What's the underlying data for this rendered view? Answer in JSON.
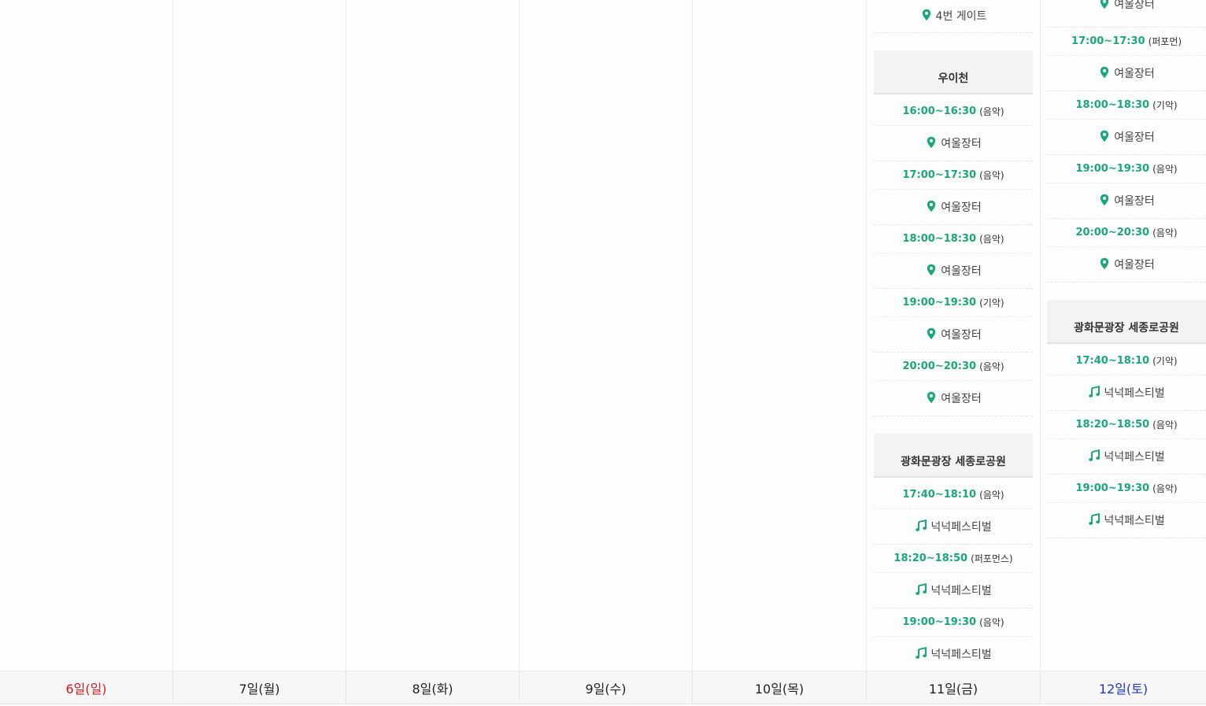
{
  "colors": {
    "time": "#1aa77a",
    "icon": "#1aa77a",
    "sunday": "#d11a1a",
    "saturday": "#2233cc"
  },
  "days": [
    {
      "label": "6일(일)"
    },
    {
      "label": "7일(월)"
    },
    {
      "label": "8일(화)"
    },
    {
      "label": "9일(수)"
    },
    {
      "label": "10일(목)"
    },
    {
      "label": "11일(금)"
    },
    {
      "label": "12일(토)"
    }
  ],
  "fri": {
    "top_place": "4번 게이트",
    "venues": [
      {
        "name": "우이천",
        "slots": [
          {
            "time": "16:00~16:30",
            "category": "(음악)",
            "place": "여울장터"
          },
          {
            "time": "17:00~17:30",
            "category": "(음악)",
            "place": "여울장터"
          },
          {
            "time": "18:00~18:30",
            "category": "(음악)",
            "place": "여울장터"
          },
          {
            "time": "19:00~19:30",
            "category": "(기악)",
            "place": "여울장터"
          },
          {
            "time": "20:00~20:30",
            "category": "(음악)",
            "place": "여울장터"
          }
        ]
      },
      {
        "name": "광화문광장 세종로공원",
        "slots": [
          {
            "time": "17:40~18:10",
            "category": "(음악)",
            "place": "넉넉페스티벌"
          },
          {
            "time": "18:20~18:50",
            "category": "(퍼포먼스)",
            "place": "넉넉페스티벌"
          },
          {
            "time": "19:00~19:30",
            "category": "(음악)",
            "place": "넉넉페스티벌"
          }
        ]
      }
    ]
  },
  "sat": {
    "top_place": "여울장터",
    "slots_a": [
      {
        "time": "17:00~17:30",
        "category": "(퍼포먼)",
        "place": "여울장터"
      },
      {
        "time": "18:00~18:30",
        "category": "(기악)",
        "place": "여울장터"
      },
      {
        "time": "19:00~19:30",
        "category": "(음악)",
        "place": "여울장터"
      },
      {
        "time": "20:00~20:30",
        "category": "(음악)",
        "place": "여울장터"
      }
    ],
    "venue_b": {
      "name": "광화문광장 세종로공원",
      "slots": [
        {
          "time": "17:40~18:10",
          "category": "(기악)",
          "place": "넉넉페스티벌"
        },
        {
          "time": "18:20~18:50",
          "category": "(음악)",
          "place": "넉넉페스티벌"
        },
        {
          "time": "19:00~19:30",
          "category": "(음악)",
          "place": "넉넉페스티벌"
        }
      ]
    }
  }
}
